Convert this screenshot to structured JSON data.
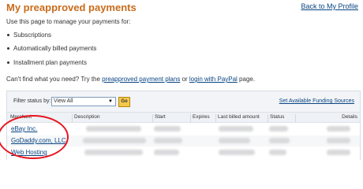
{
  "header": {
    "title": "My preapproved payments",
    "back_link": "Back to My Profile"
  },
  "intro": "Use this page to manage your payments for:",
  "bullets": [
    "Subscriptions",
    "Automatically billed payments",
    "Installment plan payments"
  ],
  "help": {
    "prefix": "Can't find what you need? Try the ",
    "link1": "preapproved payment plans",
    "middle": " or ",
    "link2": "login with PayPal",
    "suffix": " page."
  },
  "filter": {
    "label": "Filter status by:",
    "selected": "View All",
    "go_label": "Go",
    "funding_link": "Set Available Funding Sources"
  },
  "table": {
    "columns": [
      "Merchant",
      "Description",
      "Start",
      "Expires",
      "Last billed amount",
      "Status",
      "Details"
    ],
    "rows": [
      {
        "merchant": "eBay Inc."
      },
      {
        "merchant": "GoDaddy.com, LLC"
      },
      {
        "merchant": "Web Hosting"
      }
    ]
  },
  "colors": {
    "title": "#c96b1b",
    "link": "#084482",
    "highlight": "#e8141e",
    "go_button": "#f5c94e"
  }
}
